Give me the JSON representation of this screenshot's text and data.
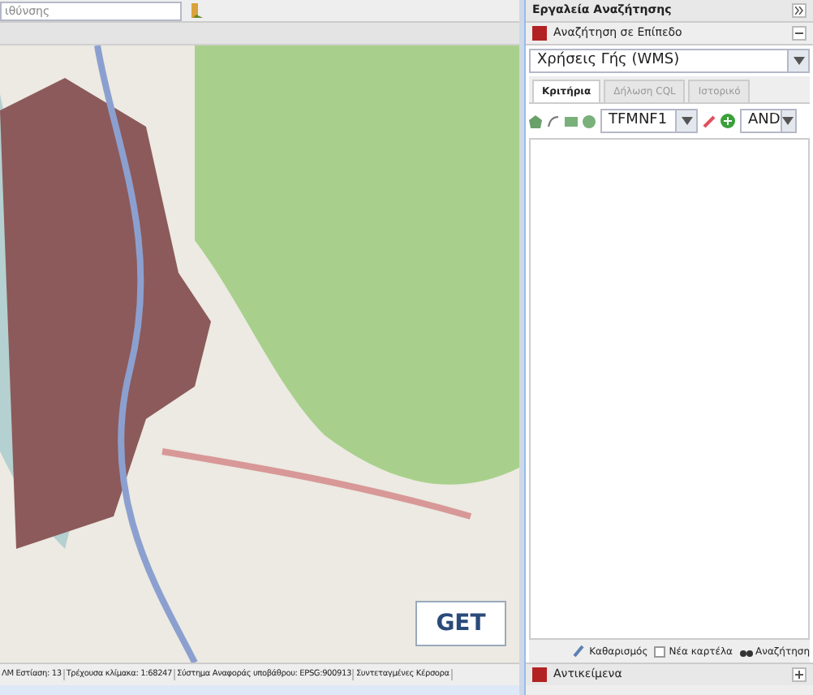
{
  "toolbar": {
    "address_field": {
      "placeholder": "ιθύνσης"
    }
  },
  "map": {
    "logo": "GET"
  },
  "status_bar": [
    "ΛΜ Εστίαση: 13",
    "Τρέχουσα κλίμακα: 1:68247",
    "Σύστημα Αναφοράς υποβάθρου: EPSG:900913",
    "Συντεταγμένες Κέρσορα"
  ],
  "search_panel": {
    "title": "Εργαλεία Αναζήτησης",
    "section": {
      "title": "Αναζήτηση σε Επίπεδο",
      "expanded": true
    },
    "layer_select": {
      "value": "Χρήσεις Γής (WMS)"
    },
    "tabs": [
      {
        "label": "Κριτήρια",
        "selected": true
      },
      {
        "label": "Δήλωση CQL",
        "selected": false
      },
      {
        "label": "Ιστορικό",
        "selected": false
      }
    ],
    "attribute_select": {
      "value": "TFMNF1"
    },
    "operator_select": {
      "value": "AND"
    },
    "actions": {
      "clear": "Καθαρισμός",
      "new_tab": {
        "label": "Νέα καρτέλα",
        "checked": false
      },
      "search": "Αναζήτηση"
    }
  },
  "results_panel": {
    "title": "Αντικείμενα",
    "expanded": false
  }
}
